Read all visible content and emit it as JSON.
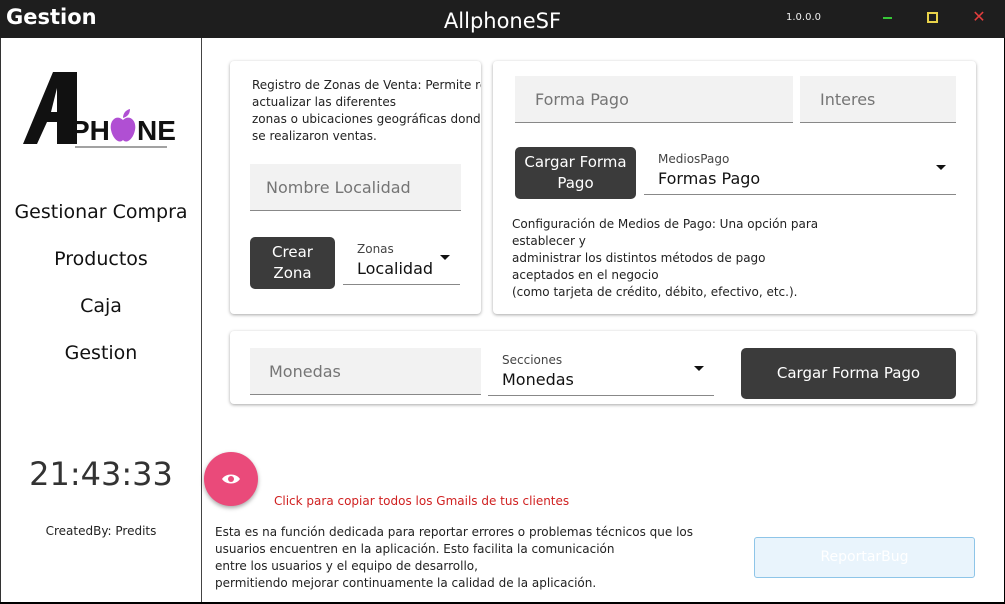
{
  "titlebar": {
    "left_title": "Gestion",
    "app_title": "AllphoneSF",
    "version": "1.0.0.0"
  },
  "sidebar": {
    "logo_text": "APHONE",
    "nav": [
      "Gestionar Compra",
      "Productos",
      "Caja",
      "Gestion"
    ],
    "clock": "21:43:33",
    "credit": "CreatedBy: Predits"
  },
  "zonas": {
    "description": "Registro de Zonas de Venta: Permite registrar y\nactualizar las diferentes\nzonas o ubicaciones geográficas donde\nse realizaron ventas.",
    "input_placeholder": "Nombre Localidad",
    "button_label": "Crear\nZona",
    "select_label": "Zonas",
    "select_value": "Localidad"
  },
  "pago": {
    "forma_placeholder": "Forma Pago",
    "interes_placeholder": "Interes",
    "button_label": "Cargar Forma\nPago",
    "select_label": "MediosPago",
    "select_value": "Formas Pago",
    "description": "Configuración de Medios de Pago: Una opción para\nestablecer y\nadministrar los distintos métodos de pago\naceptados en el negocio\n(como tarjeta de crédito, débito, efectivo, etc.)."
  },
  "monedas": {
    "input_placeholder": "Monedas",
    "select_label": "Secciones",
    "select_value": "Monedas",
    "button_label": "Cargar Forma Pago"
  },
  "footer": {
    "copy_text": "Click para copiar todos los Gmails de tus clientes",
    "bug_description": "Esta es na función dedicada para reportar errores o problemas técnicos que los\nusuarios encuentren en la aplicación. Esto facilita la comunicación\nentre los usuarios y el equipo de desarrollo,\npermitiendo mejorar continuamente la calidad de la aplicación.",
    "report_button": "ReportarBug"
  },
  "colors": {
    "accent_pink": "#ea4a7a",
    "button_dark": "#3b3b3b",
    "warning_red": "#d02020"
  }
}
